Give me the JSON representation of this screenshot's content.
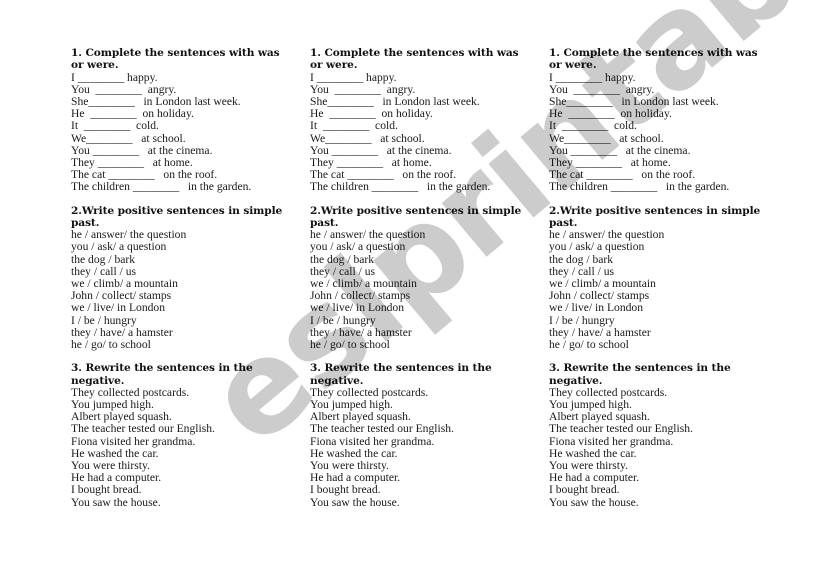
{
  "watermark": "eslprintables.com",
  "columns": [
    {
      "sections": [
        {
          "heading": "1. Complete the sentences with was or were.",
          "lines": [
            "I ________ happy.",
            "You  ________  angry.",
            "She________   in London last week.",
            "He  ________  on holiday.",
            "It  ________  cold.",
            "We________   at school.",
            "You ________   at the cinema.",
            "They ________   at home.",
            "The cat ________   on the roof.",
            "The children ________   in the garden."
          ]
        },
        {
          "heading": "2.Write positive sentences in simple past.",
          "lines": [
            "he / answer/ the question",
            "you / ask/ a question",
            "the dog / bark",
            "they / call / us",
            "we / climb/ a mountain",
            "John / collect/ stamps",
            "we / live/ in London",
            "I / be / hungry",
            "they / have/ a hamster",
            "he / go/ to school"
          ]
        },
        {
          "heading": "3. Rewrite the sentences in the negative.",
          "lines": [
            "They collected postcards.",
            "You jumped high.",
            "Albert played squash.",
            "The teacher tested our English.",
            "Fiona visited her grandma.",
            "He washed the car.",
            "You were thirsty.",
            "He had a computer.",
            "I bought bread.",
            "You saw the house."
          ]
        }
      ]
    },
    {
      "sections": [
        {
          "heading": "1. Complete the sentences with was or were.",
          "lines": [
            "I ________ happy.",
            "You  ________  angry.",
            "She________   in London last week.",
            "He  ________  on holiday.",
            "It  ________  cold.",
            "We________   at school.",
            "You ________   at the cinema.",
            "They ________   at home.",
            "The cat ________   on the roof.",
            "The children ________   in the garden."
          ]
        },
        {
          "heading": "2.Write positive sentences in simple past.",
          "lines": [
            "he / answer/ the question",
            "you / ask/ a question",
            "the dog / bark",
            "they / call / us",
            "we / climb/ a mountain",
            "John / collect/ stamps",
            "we / live/ in London",
            "I / be / hungry",
            "they / have/ a hamster",
            "he / go/ to school"
          ]
        },
        {
          "heading": "3. Rewrite the sentences in the negative.",
          "lines": [
            "They collected postcards.",
            "You jumped high.",
            "Albert played squash.",
            "The teacher tested our English.",
            "Fiona visited her grandma.",
            "He washed the car.",
            "You were thirsty.",
            "He had a computer.",
            "I bought bread.",
            "You saw the house."
          ]
        }
      ]
    },
    {
      "sections": [
        {
          "heading": "1. Complete the sentences with was or were.",
          "lines": [
            "I ________ happy.",
            "You  ________  angry.",
            "She________   in London last week.",
            "He  ________  on holiday.",
            "It  ________  cold.",
            "We________   at school.",
            "You ________   at the cinema.",
            "They ________   at home.",
            "The cat ________   on the roof.",
            "The children ________   in the garden."
          ]
        },
        {
          "heading": "2.Write positive sentences in simple past.",
          "lines": [
            "he / answer/ the question",
            "you / ask/ a question",
            "the dog / bark",
            "they / call / us",
            "we / climb/ a mountain",
            "John / collect/ stamps",
            "we / live/ in London",
            "I / be / hungry",
            "they / have/ a hamster",
            "he / go/ to school"
          ]
        },
        {
          "heading": "3. Rewrite the sentences in the negative.",
          "lines": [
            "They collected postcards.",
            "You jumped high.",
            "Albert played squash.",
            "The teacher tested our English.",
            "Fiona visited her grandma.",
            "He washed the car.",
            "You were thirsty.",
            "He had a computer.",
            "I bought bread.",
            "You saw the house."
          ]
        }
      ]
    }
  ]
}
